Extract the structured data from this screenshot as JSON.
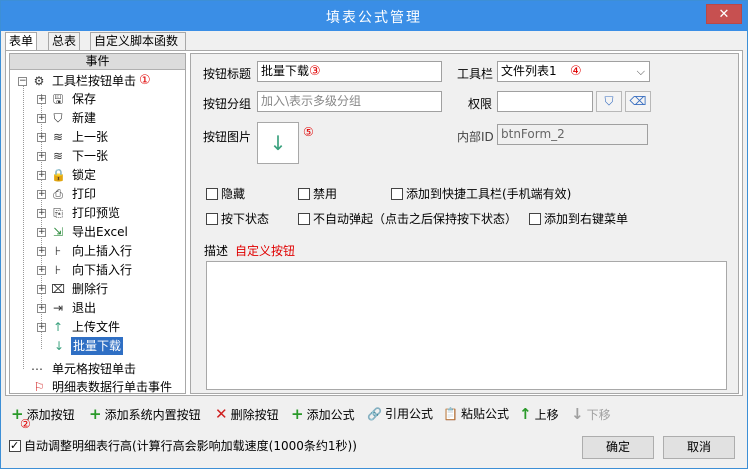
{
  "window": {
    "title": "填表公式管理",
    "close": "✕"
  },
  "tabs": [
    {
      "label": "表单",
      "active": true
    },
    {
      "label": "总表",
      "active": false
    },
    {
      "label": "自定义脚本函数",
      "active": false
    }
  ],
  "tree": {
    "header": "事件",
    "root": {
      "label": "工具栏按钮单击",
      "marker": "①"
    },
    "items": [
      {
        "label": "保存",
        "icon": "save-icon"
      },
      {
        "label": "新建",
        "icon": "shield-icon"
      },
      {
        "label": "上一张",
        "icon": "layers-up-icon"
      },
      {
        "label": "下一张",
        "icon": "layers-down-icon"
      },
      {
        "label": "锁定",
        "icon": "lock-icon"
      },
      {
        "label": "打印",
        "icon": "print-icon"
      },
      {
        "label": "打印预览",
        "icon": "print-preview-icon"
      },
      {
        "label": "导出Excel",
        "icon": "export-icon"
      },
      {
        "label": "向上插入行",
        "icon": "insert-up-icon"
      },
      {
        "label": "向下插入行",
        "icon": "insert-down-icon"
      },
      {
        "label": "删除行",
        "icon": "delete-row-icon"
      },
      {
        "label": "退出",
        "icon": "exit-icon"
      },
      {
        "label": "上传文件",
        "icon": "upload-icon"
      }
    ],
    "selected": "批量下载",
    "other": [
      {
        "label": "单元格按钮单击",
        "icon": "dots-icon"
      },
      {
        "label": "明细表数据行单击事件",
        "icon": "flag-icon"
      }
    ]
  },
  "form": {
    "title_label": "按钮标题",
    "title_value": "批量下载",
    "title_marker": "③",
    "toolbar_label": "工具栏",
    "toolbar_value": "文件列表1",
    "toolbar_marker": "④",
    "group_label": "按钮分组",
    "group_placeholder": "加入\\表示多级分组",
    "perm_label": "权限",
    "perm_value": "",
    "image_label": "按钮图片",
    "image_marker": "⑤",
    "id_label": "内部ID",
    "id_value": "btnForm_2",
    "checks": [
      {
        "label": "隐藏",
        "checked": false
      },
      {
        "label": "禁用",
        "checked": false
      },
      {
        "label": "添加到快捷工具栏(手机端有效)",
        "checked": false
      },
      {
        "label": "按下状态",
        "checked": false
      },
      {
        "label": "不自动弹起（点击之后保持按下状态）",
        "checked": false
      },
      {
        "label": "添加到右键菜单",
        "checked": false
      }
    ],
    "desc_label": "描述",
    "desc_value": "自定义按钮"
  },
  "toolbar": {
    "add_button": "添加按钮",
    "add_button_marker": "②",
    "add_system": "添加系统内置按钮",
    "delete_button": "删除按钮",
    "add_formula": "添加公式",
    "ref_formula": "引用公式",
    "paste_formula": "粘贴公式",
    "move_up": "上移",
    "move_down": "下移"
  },
  "footer": {
    "auto_height": "自动调整明细表行高(计算行高会影响加载速度(1000条约1秒))",
    "auto_height_checked": true,
    "ok": "确定",
    "cancel": "取消"
  },
  "colors": {
    "titlebar": "#3a8ee6",
    "selected": "#2f6fc4",
    "marker": "#e00000"
  }
}
